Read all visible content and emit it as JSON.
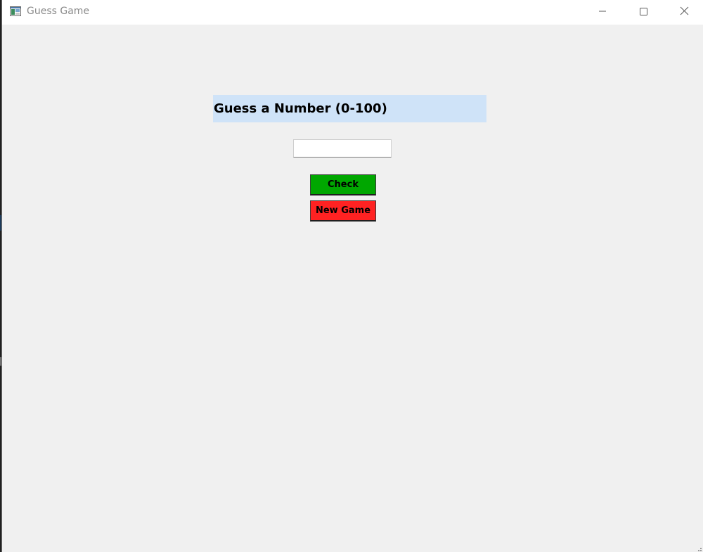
{
  "window": {
    "title": "Guess Game",
    "app_icon": "tk-window-icon",
    "controls": {
      "minimize_icon": "minimize-icon",
      "maximize_icon": "maximize-icon",
      "close_icon": "close-icon"
    }
  },
  "main": {
    "heading": "Guess a Number (0-100)",
    "guess_input": {
      "value": "",
      "placeholder": ""
    },
    "check_button": "Check",
    "new_game_button": "New Game"
  },
  "colors": {
    "heading_bg": "#cfe3f8",
    "check_button_bg": "#00a700",
    "new_game_button_bg": "#ff2222",
    "window_bg": "#f0f0f0"
  }
}
